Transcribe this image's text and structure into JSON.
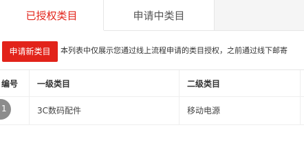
{
  "tabs": [
    {
      "label": "已授权类目",
      "active": true
    },
    {
      "label": "申请中类目",
      "active": false
    }
  ],
  "toolbar": {
    "new_button_label": "申请新类目",
    "notice": "本列表中仅展示您通过线上流程申请的类目授权，之前通过线下邮寄"
  },
  "table": {
    "headers": [
      "编号",
      "一级类目",
      "二级类目"
    ],
    "rows": [
      {
        "num": "1",
        "level1": "3C数码配件",
        "level2": "移动电源"
      }
    ]
  },
  "colors": {
    "accent": "#e2231a",
    "badge": "#8c8c8c"
  }
}
